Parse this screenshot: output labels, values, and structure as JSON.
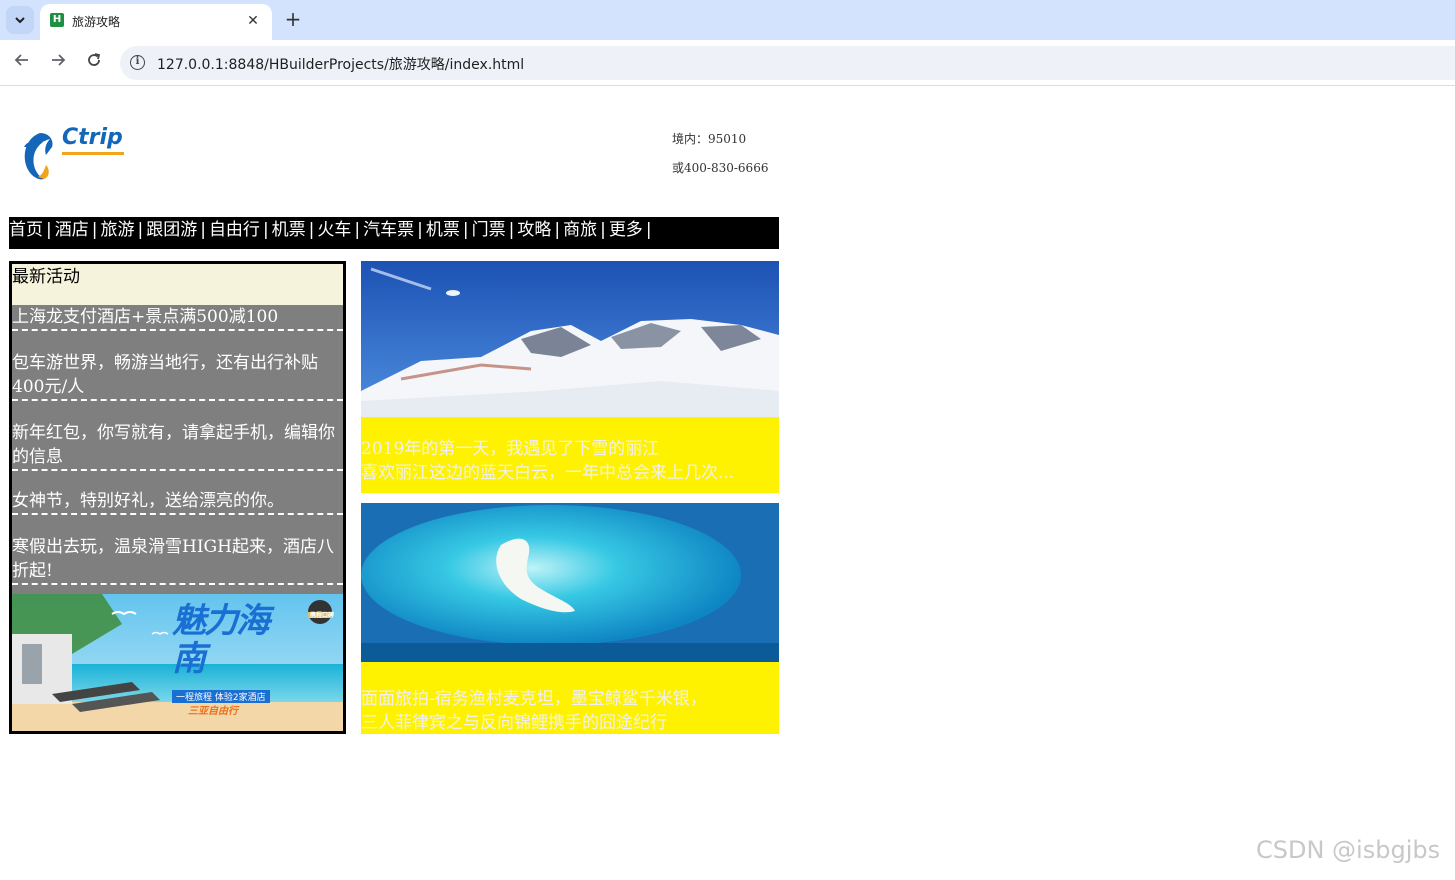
{
  "browser": {
    "tab_title": "旅游攻略",
    "tab_favicon": "H",
    "tab_close": "✕",
    "new_tab": "+",
    "url": "127.0.0.1:8848/HBuilderProjects/旅游攻略/index.html"
  },
  "header": {
    "logo_text": "Ctrip",
    "phone_line1": "境内：95010",
    "phone_line2": "或400-830-6666"
  },
  "nav": {
    "items": [
      "首页",
      "酒店",
      "旅游",
      "跟团游",
      "自由行",
      "机票",
      "火车",
      "汽车票",
      "机票",
      "门票",
      "攻略",
      "商旅",
      "更多"
    ],
    "separator": "|"
  },
  "activity": {
    "title": "最新活动",
    "items": [
      "上海龙支付酒店+景点满500减100",
      "包车游世界，畅游当地行，还有出行补贴400元/人",
      "新年红包，你写就有，请拿起手机，编辑你的信息",
      "女神节，特别好礼，送给漂亮的你。",
      "寒假出去玩，温泉滑雪HIGH起来，酒店八折起!"
    ],
    "banner": {
      "title": "魅力海南",
      "subtitle": "一程旅程 体验2家酒店",
      "tag": "三亚自由行",
      "badge": "携程口碑"
    }
  },
  "cards": [
    {
      "line1": "2019年的第一天，我遇见了下雪的丽江",
      "line2": "喜欢丽江这边的蓝天白云，一年中总会来上几次..."
    },
    {
      "line1": "面面旅拍-宿务渔村麦克坦，墨宝鲸鲨千米银，",
      "line2": "三人菲律宾之与反向锦鲤携手的囧途纪行"
    }
  ],
  "watermark": "CSDN @isbgjbs",
  "colors": {
    "tabbar": "#d3e3fd",
    "nav_bg": "#000000",
    "activity_header": "#f6f3dc",
    "activity_list": "#7f7f7f",
    "card_bg": "#fff200"
  }
}
